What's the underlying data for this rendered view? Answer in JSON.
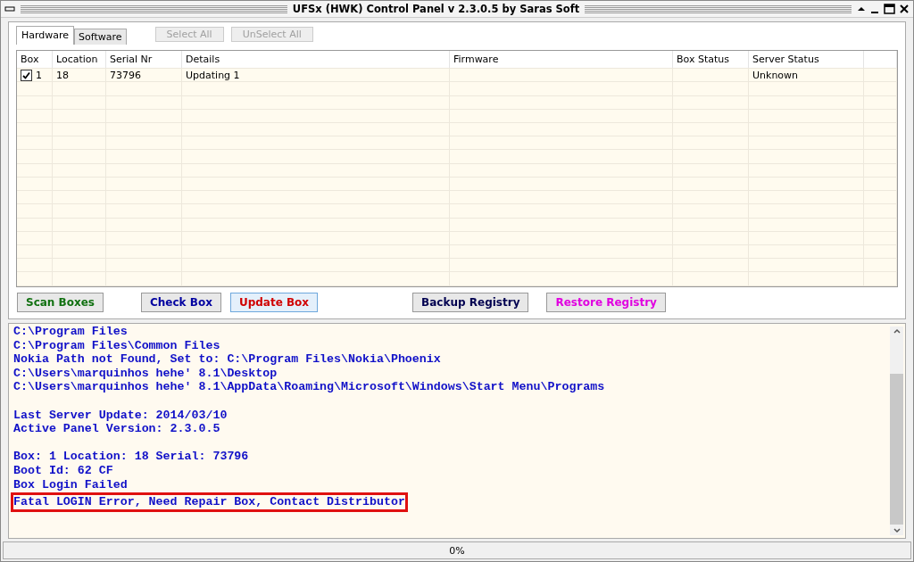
{
  "window": {
    "title": "UFSx (HWK) Control Panel v 2.3.0.5 by Saras Soft"
  },
  "tabs": [
    {
      "label": "Hardware",
      "selected": true
    },
    {
      "label": "Software",
      "selected": false
    }
  ],
  "selection_buttons": [
    {
      "label": "Select All",
      "disabled": true
    },
    {
      "label": "UnSelect All",
      "disabled": true
    }
  ],
  "table": {
    "columns": [
      "Box",
      "Location",
      "Serial Nr",
      "Details",
      "Firmware",
      "Box Status",
      "Server Status"
    ],
    "rows": [
      {
        "checked": true,
        "cells": [
          "1",
          "18",
          "73796",
          "Updating 1",
          "",
          "",
          "Unknown"
        ]
      }
    ]
  },
  "actions": [
    {
      "label": "Scan Boxes",
      "color": "#107010",
      "focused": false
    },
    {
      "label": "Check Box",
      "color": "#0000a0",
      "focused": false
    },
    {
      "label": "Update Box",
      "color": "#d00000",
      "focused": true
    },
    {
      "label": "Backup Registry",
      "color": "#000050",
      "focused": false
    },
    {
      "label": "Restore Registry",
      "color": "#e000e0",
      "focused": false
    }
  ],
  "log": [
    [
      {
        "text": "C:\\Program Files",
        "highlighted": false
      },
      {
        "text": "C:\\Program Files\\Common Files",
        "highlighted": false
      },
      {
        "text": "Nokia Path not Found, Set to: C:\\Program Files\\Nokia\\Phoenix",
        "highlighted": false
      },
      {
        "text": "C:\\Users\\marquinhos hehe' 8.1\\Desktop",
        "highlighted": false
      },
      {
        "text": "C:\\Users\\marquinhos hehe' 8.1\\AppData\\Roaming\\Microsoft\\Windows\\Start Menu\\Programs",
        "highlighted": false
      }
    ],
    [
      {
        "text": "Last Server Update: 2014/03/10",
        "highlighted": false
      },
      {
        "text": "Active Panel Version: 2.3.0.5",
        "highlighted": false
      }
    ],
    [
      {
        "text": "Box: 1 Location: 18 Serial: 73796",
        "highlighted": false
      },
      {
        "text": "Boot Id: 62 CF",
        "highlighted": false
      },
      {
        "text": "Box Login Failed",
        "highlighted": false
      },
      {
        "text": "Fatal LOGIN Error, Need Repair Box, Contact Distributor",
        "highlighted": true
      }
    ]
  ],
  "status_bar": {
    "progress": "0%"
  }
}
